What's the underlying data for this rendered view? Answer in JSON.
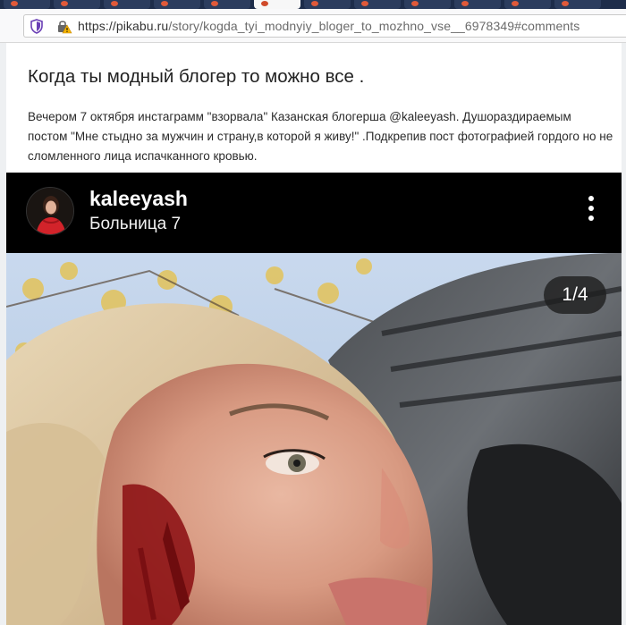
{
  "browser": {
    "url_host": "https://pikabu.ru",
    "url_path": "/story/kogda_tyi_modnyiy_bloger_to_mozhno_vse__6978349#comments"
  },
  "story": {
    "title": "Когда ты модный блогер то можно все .",
    "description": "Вечером 7 октября инстаграмм \"взорвала\" Казанская блогерша @kaleeyash. Душораздираемым постом \"Мне стыдно за мужчин и страну,в которой я живу!\" .Подкрепив пост фотографией гордого но не сломленного лица испачканного кровью."
  },
  "instagram_post": {
    "username": "kaleeyash",
    "location": "Больница 7",
    "counter": "1/4",
    "more_icon": "more-vertical-icon"
  },
  "colors": {
    "page_bg": "#eef0f2",
    "post_bg": "#000000",
    "counter_bg": "#1e1e1e"
  }
}
